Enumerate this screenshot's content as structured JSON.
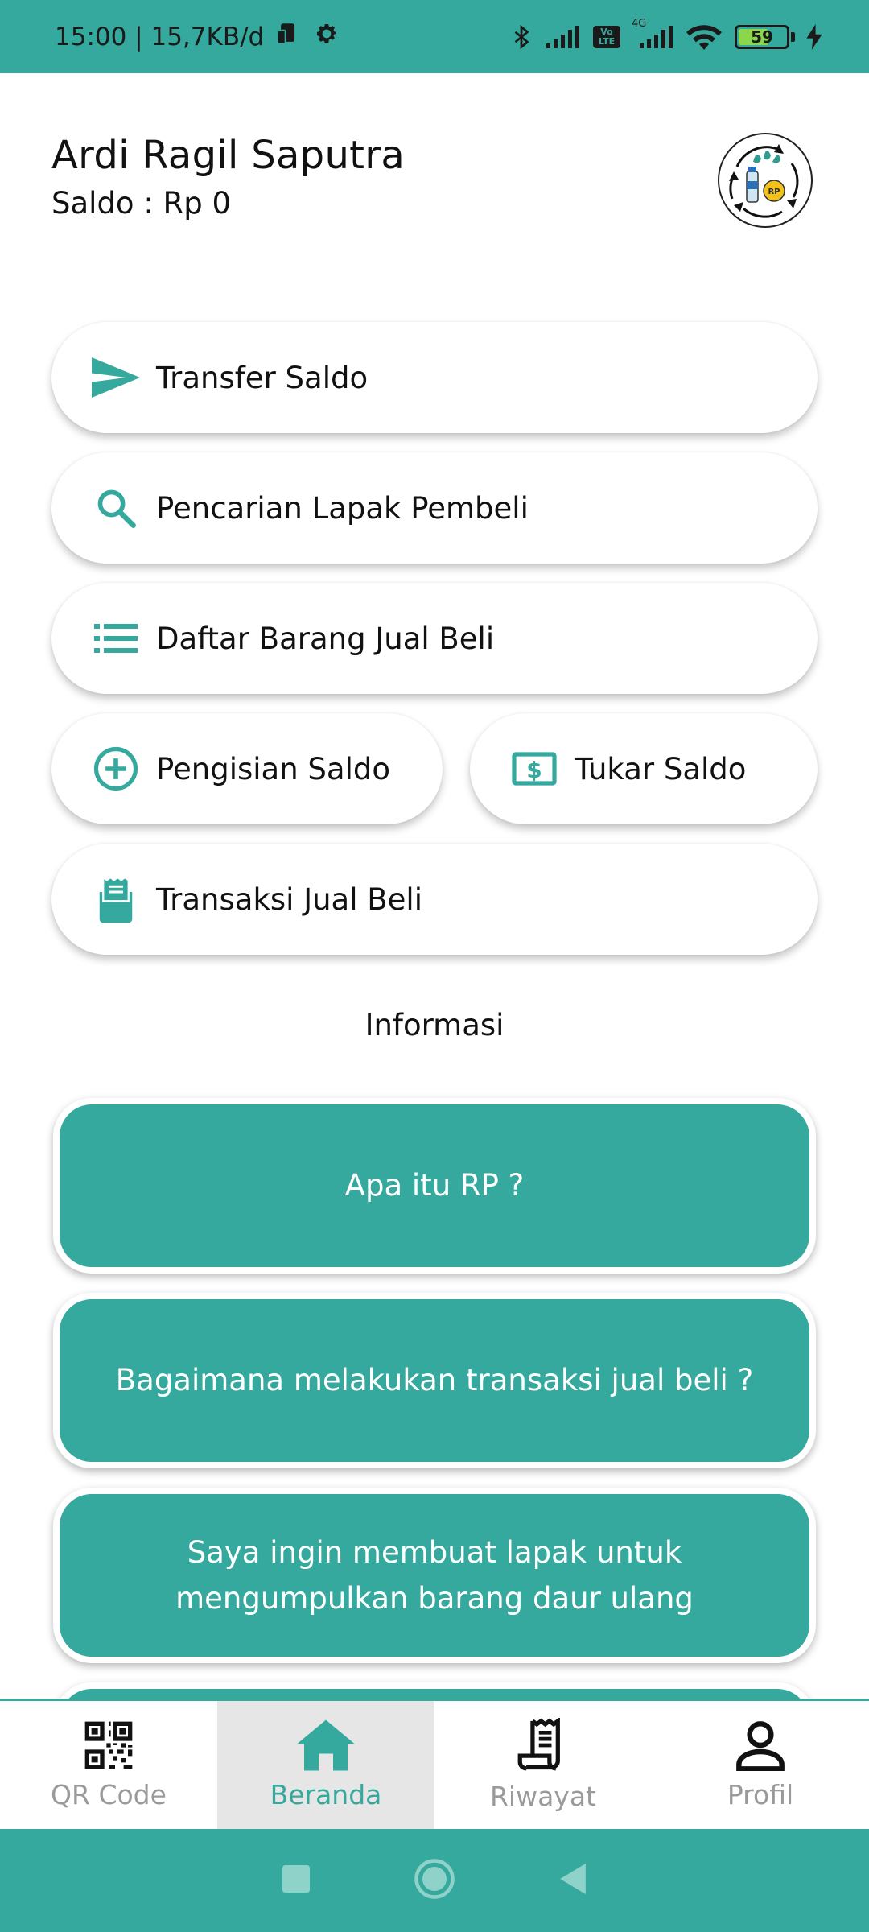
{
  "status_bar": {
    "time_speed": "15:00 | 15,7KB/d",
    "network_badge": "Vo LTE",
    "network_type": "4G",
    "battery_level": "59"
  },
  "header": {
    "user_name": "Ardi Ragil Saputra",
    "balance": "Saldo : Rp 0",
    "logo_text": "RP"
  },
  "menu": {
    "transfer_label": "Transfer Saldo",
    "search_label": "Pencarian Lapak Pembeli",
    "list_label": "Daftar Barang Jual Beli",
    "topup_label": "Pengisian Saldo",
    "exchange_label": "Tukar Saldo",
    "transaction_label": "Transaksi Jual Beli"
  },
  "info": {
    "title": "Informasi",
    "cards": [
      "Apa itu RP ?",
      "Bagaimana melakukan transaksi jual beli ?",
      "Saya ingin membuat lapak untuk mengumpulkan barang daur ulang"
    ]
  },
  "bottom_nav": {
    "items": [
      {
        "label": "QR Code",
        "icon": "qr-code-icon"
      },
      {
        "label": "Beranda",
        "icon": "home-icon",
        "active": true
      },
      {
        "label": "Riwayat",
        "icon": "receipt-icon"
      },
      {
        "label": "Profil",
        "icon": "person-icon"
      }
    ]
  },
  "colors": {
    "primary": "#35a99d",
    "nav_inactive": "#9a9a9a",
    "nav_active_bg": "#e6e6e6"
  }
}
